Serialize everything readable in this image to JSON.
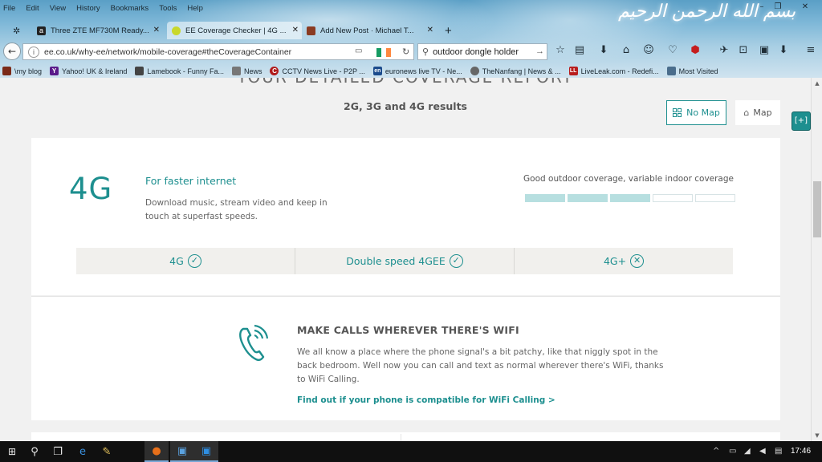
{
  "menu": [
    "File",
    "Edit",
    "View",
    "History",
    "Bookmarks",
    "Tools",
    "Help"
  ],
  "calligraphy": "بسم الله الرحمن الرحيم",
  "tabs": [
    {
      "title": "Three ZTE MF730M Ready..."
    },
    {
      "title": "EE Coverage Checker | 4G ..."
    },
    {
      "title": "Add New Post · Michael T..."
    }
  ],
  "url": "ee.co.uk/why-ee/network/mobile-coverage#theCoverageContainer",
  "search_value": "outdoor dongle holder",
  "bookmarks": [
    {
      "label": "\\my blog",
      "icon_color": "#7b2a18"
    },
    {
      "label": "Yahoo! UK & Ireland",
      "icon_color": "#5a1a8a",
      "glyph": "Y"
    },
    {
      "label": "Lamebook - Funny Fa...",
      "icon_color": "#444444"
    },
    {
      "label": "News",
      "icon_color": "#777777"
    },
    {
      "label": "CCTV News Live - P2P ...",
      "icon_color": "#b01a1a",
      "glyph": "C"
    },
    {
      "label": "euronews live TV - Ne...",
      "icon_color": "#1b4b8c",
      "glyph": "en"
    },
    {
      "label": "TheNanfang | News & ...",
      "icon_color": "#666666"
    },
    {
      "label": "LiveLeak.com - Redefi...",
      "icon_color": "#b81d1d",
      "glyph": "LL"
    },
    {
      "label": "Most Visited",
      "icon_color": "#4a6d8c"
    }
  ],
  "page": {
    "cut_heading": "YOUR DETAILED COVERAGE REPORT",
    "results_title": "2G, 3G and 4G results",
    "no_map_label": "No Map",
    "map_label": "Map",
    "network": {
      "name": "4G",
      "tagline": "For faster internet",
      "description": "Download music, stream video and keep in touch at superfast speeds.",
      "coverage_text": "Good outdoor coverage, variable indoor coverage",
      "coverage_level": 3,
      "coverage_max": 5
    },
    "features": [
      {
        "label": "4G",
        "available": true
      },
      {
        "label": "Double speed 4GEE",
        "available": true
      },
      {
        "label": "4G+",
        "available": false
      }
    ],
    "wifi": {
      "title": "MAKE CALLS WHEREVER THERE'S WIFI",
      "description": "We all know a place where the phone signal's a bit patchy, like that niggly spot in the back bedroom. Well now you can call and text as normal wherever there's WiFi, thanks to WiFi Calling.",
      "link": "Find out if your phone is compatible for WiFi Calling >"
    },
    "side_button": "[+]"
  },
  "taskbar": {
    "clock": "17:46"
  },
  "colors": {
    "ee_teal": "#1d8f8f",
    "coverage_fill": "#b7dfe0",
    "page_bg": "#f1f1f1"
  }
}
